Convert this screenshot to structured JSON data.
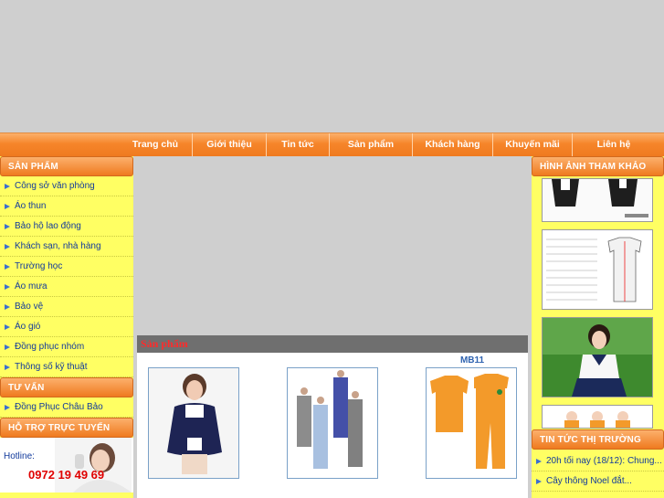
{
  "nav": {
    "items": [
      "Trang chủ",
      "Giới thiệu",
      "Tin tức",
      "Sản phẩm",
      "Khách hàng",
      "Khuyến mãi",
      "Liên hệ"
    ]
  },
  "left": {
    "products_header": "SẢN PHẨM",
    "products": [
      "Công sở văn phòng",
      "Áo thun",
      "Bảo hộ lao động",
      "Khách sạn, nhà hàng",
      "Trường học",
      "Áo mưa",
      "Bảo vệ",
      "Áo gió",
      "Đồng phục nhóm",
      "Thông số kỹ thuật"
    ],
    "advice_header": "TƯ VẤN",
    "advice": [
      "Đồng Phục Châu Bảo"
    ],
    "support_header": "HỖ TRỢ TRỰC TUYẾN",
    "hotline_label": "Hotline:",
    "hotline_number": "0972 19 49 69"
  },
  "center": {
    "section_title": "Sản phẩm",
    "products": [
      {
        "name": ""
      },
      {
        "name": ""
      },
      {
        "name": "MB11"
      }
    ]
  },
  "right": {
    "gallery_header": "HÌNH ẢNH THAM KHẢO",
    "news_header": "TIN TỨC THỊ TRƯỜNG",
    "news": [
      "20h tối nay (18/12): Chung...",
      "Cây thông Noel đắt..."
    ]
  },
  "colors": {
    "nav_orange": "#f6852a",
    "sidebar_yellow": "#ffff63",
    "link_blue": "#123a9c",
    "hotline_red": "#e00000",
    "title_red": "#ff2b2b"
  }
}
